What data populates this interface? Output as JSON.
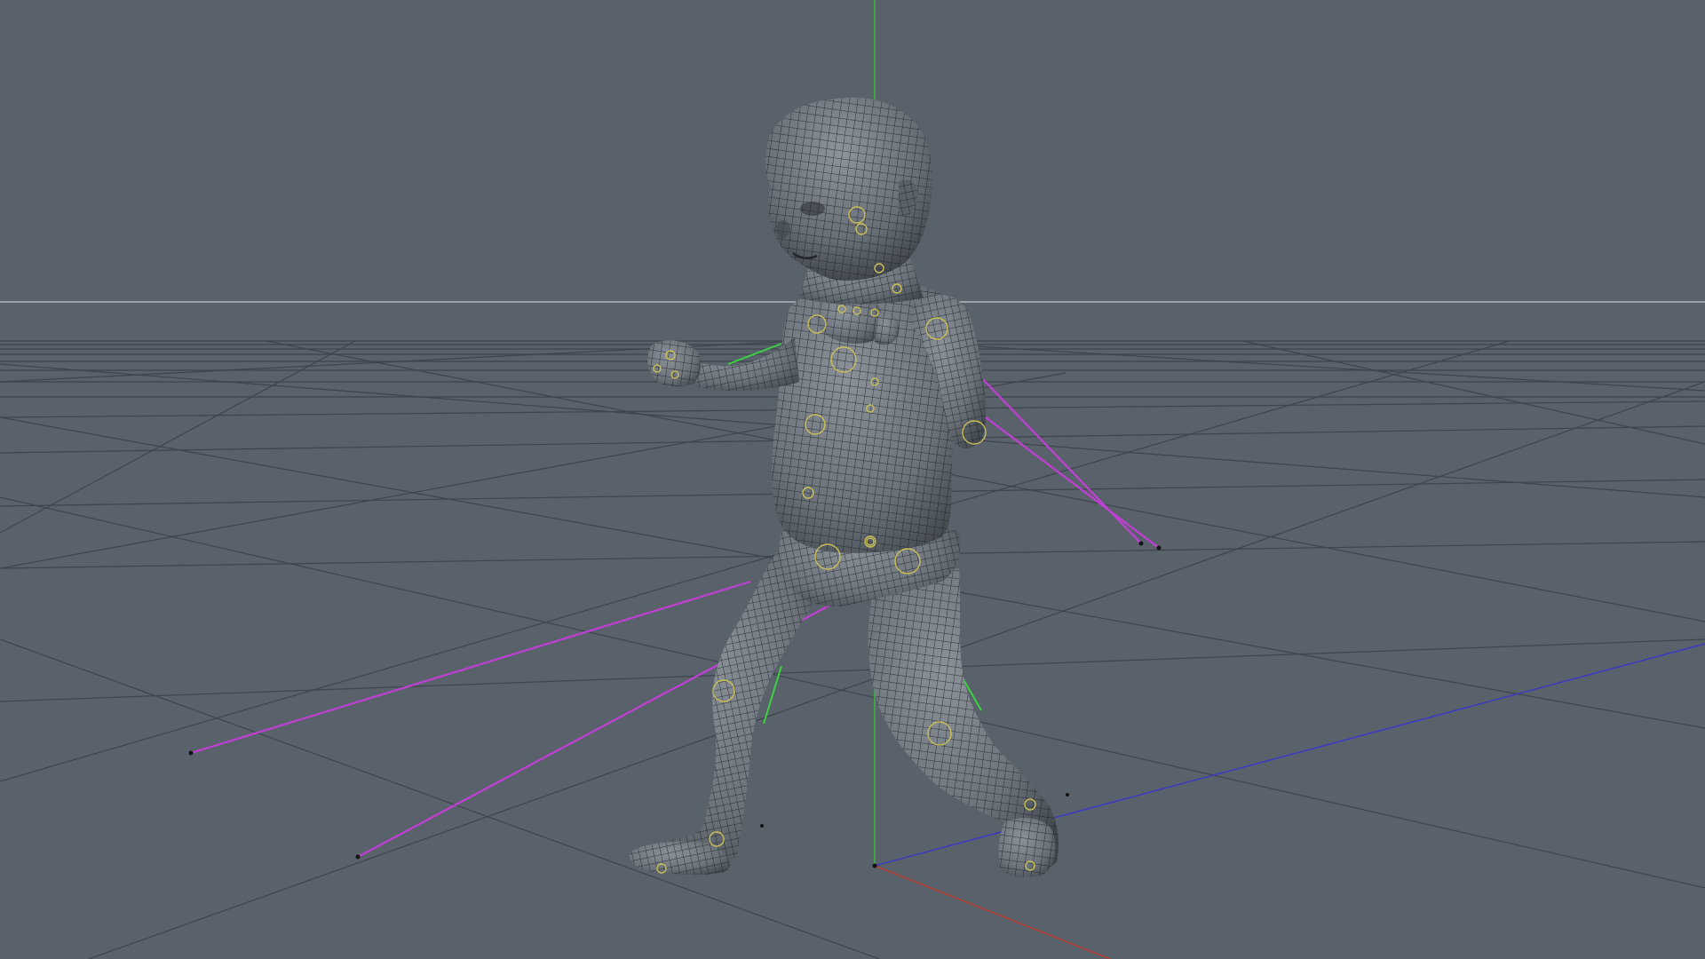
{
  "viewport": {
    "background_color": "#59616b",
    "grid_color": "#3d444c",
    "horizon_color": "#b3b8bd"
  },
  "axes": {
    "x_color": "#c0392b",
    "y_color": "#36c23a",
    "z_color": "#3a36c8"
  },
  "rig": {
    "ik_line_color": "#c23fd6",
    "pole_line_color": "#3bd13f",
    "joint_color": "#c9bf55"
  },
  "mesh": {
    "fill_color": "#6e757d",
    "wire_color": "#1f2226"
  }
}
